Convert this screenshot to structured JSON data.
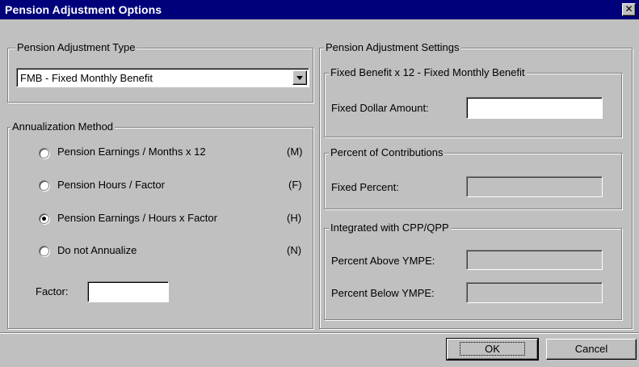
{
  "window": {
    "title": "Pension Adjustment Options",
    "close_glyph": "✕"
  },
  "adjustment_type": {
    "legend": "Pension Adjustment Type",
    "selected": "FMB - Fixed Monthly Benefit"
  },
  "annualization": {
    "legend": "Annualization Method",
    "options": [
      {
        "label": "Pension Earnings / Months  x  12",
        "key": "(M)",
        "checked": false
      },
      {
        "label": "Pension Hours / Factor",
        "key": "(F)",
        "checked": false
      },
      {
        "label": "Pension Earnings / Hours  x  Factor",
        "key": "(H)",
        "checked": true
      },
      {
        "label": "Do not Annualize",
        "key": "(N)",
        "checked": false
      }
    ],
    "factor_label": "Factor:",
    "factor_value": ""
  },
  "settings": {
    "legend": "Pension Adjustment Settings",
    "fixed_benefit": {
      "legend": "Fixed Benefit x 12 - Fixed Monthly Benefit",
      "amount_label": "Fixed Dollar Amount:",
      "amount_value": ""
    },
    "percent_contrib": {
      "legend": "Percent of Contributions",
      "percent_label": "Fixed Percent:",
      "percent_value": ""
    },
    "integrated": {
      "legend": "Integrated with CPP/QPP",
      "above_label": "Percent Above YMPE:",
      "below_label": "Percent Below YMPE:"
    }
  },
  "buttons": {
    "ok": "OK",
    "cancel": "Cancel"
  }
}
